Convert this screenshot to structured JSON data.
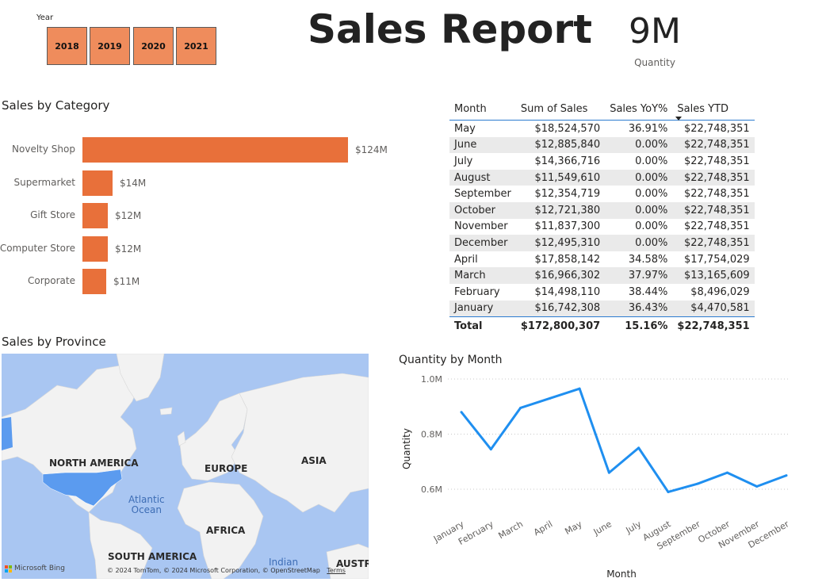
{
  "slicer": {
    "label": "Year",
    "years": [
      "2018",
      "2019",
      "2020",
      "2021"
    ]
  },
  "report": {
    "title": "Sales Report"
  },
  "kpi": {
    "value": "9M",
    "label": "Quantity"
  },
  "sales_by_category": {
    "title": "Sales by Category",
    "items": [
      {
        "label": "Novelty Shop",
        "value": 124,
        "display": "$124M"
      },
      {
        "label": "Supermarket",
        "value": 14,
        "display": "$14M"
      },
      {
        "label": "Gift Store",
        "value": 12,
        "display": "$12M"
      },
      {
        "label": "Computer Store",
        "value": 12,
        "display": "$12M"
      },
      {
        "label": "Corporate",
        "value": 11,
        "display": "$11M"
      }
    ]
  },
  "table": {
    "headers": [
      "Month",
      "Sum of Sales",
      "Sales YoY%",
      "Sales YTD"
    ],
    "rows": [
      [
        "May",
        "$18,524,570",
        "36.91%",
        "$22,748,351"
      ],
      [
        "June",
        "$12,885,840",
        "0.00%",
        "$22,748,351"
      ],
      [
        "July",
        "$14,366,716",
        "0.00%",
        "$22,748,351"
      ],
      [
        "August",
        "$11,549,610",
        "0.00%",
        "$22,748,351"
      ],
      [
        "September",
        "$12,354,719",
        "0.00%",
        "$22,748,351"
      ],
      [
        "October",
        "$12,721,380",
        "0.00%",
        "$22,748,351"
      ],
      [
        "November",
        "$11,837,300",
        "0.00%",
        "$22,748,351"
      ],
      [
        "December",
        "$12,495,310",
        "0.00%",
        "$22,748,351"
      ],
      [
        "April",
        "$17,858,142",
        "34.58%",
        "$17,754,029"
      ],
      [
        "March",
        "$16,966,302",
        "37.97%",
        "$13,165,609"
      ],
      [
        "February",
        "$14,498,110",
        "38.44%",
        "$8,496,029"
      ],
      [
        "January",
        "$16,742,308",
        "36.43%",
        "$4,470,581"
      ]
    ],
    "total": [
      "Total",
      "$172,800,307",
      "15.16%",
      "$22,748,351"
    ]
  },
  "map": {
    "title": "Sales by Province",
    "labels": {
      "north_america": "NORTH AMERICA",
      "europe": "EUROPE",
      "asia": "ASIA",
      "africa": "AFRICA",
      "south_america": "SOUTH AMERICA",
      "australia": "AUSTRA",
      "atlantic": "Atlantic",
      "atlantic2": "Ocean",
      "indian": "Indian"
    },
    "attribution": "© 2024 TomTom, © 2024 Microsoft Corporation, © OpenStreetMap",
    "terms": "Terms",
    "provider": "Microsoft Bing",
    "land_color": "#f2f2f2",
    "water_color": "#a9c6f2",
    "highlight_color": "#5b9bef"
  },
  "chart_data": {
    "type": "line",
    "title": "Quantity by Month",
    "xlabel": "Month",
    "ylabel": "Quantity",
    "categories": [
      "January",
      "February",
      "March",
      "April",
      "May",
      "June",
      "July",
      "August",
      "September",
      "October",
      "November",
      "December"
    ],
    "values": [
      0.88,
      0.745,
      0.895,
      0.93,
      0.965,
      0.66,
      0.75,
      0.59,
      0.62,
      0.66,
      0.61,
      0.65
    ],
    "unit": "M",
    "yticks": [
      "0.6M",
      "0.8M",
      "1.0M"
    ],
    "ytick_values": [
      0.6,
      0.8,
      1.0
    ],
    "ylim": [
      0.55,
      1.0
    ],
    "color": "#1f8ff0",
    "grid": true
  }
}
